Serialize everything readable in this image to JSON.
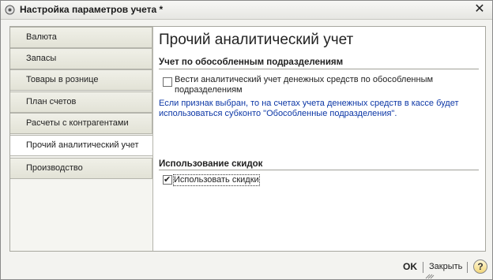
{
  "window": {
    "title": "Настройка параметров учета *",
    "close_icon": "close-icon"
  },
  "sidebar": {
    "items": [
      {
        "label": "Валюта",
        "active": false
      },
      {
        "label": "Запасы",
        "active": false
      },
      {
        "label": "Товары в рознице",
        "active": false
      },
      {
        "label": "План счетов",
        "active": false
      },
      {
        "label": "Расчеты с контрагентами",
        "active": false
      },
      {
        "label": "Прочий аналитический учет",
        "active": true
      },
      {
        "label": "Производство",
        "active": false
      }
    ]
  },
  "main": {
    "title": "Прочий аналитический учет",
    "sections": [
      {
        "title": "Учет по обособленным подразделениям",
        "checkbox_label_line1": "Вести аналитический учет денежных средств по обособленным",
        "checkbox_label_line2": "подразделениям",
        "checked": false,
        "hint_line1": "Если признак выбран, то на счетах учета денежных средств в кассе будет",
        "hint_line2": "использоваться субконто \"Обособленные подразделения\"."
      },
      {
        "title": "Использование скидок",
        "checkbox_label": "Использовать скидки",
        "checked": true
      }
    ]
  },
  "footer": {
    "ok_label": "OK",
    "close_label": "Закрыть",
    "help_label": "?"
  },
  "colors": {
    "hint": "#0c37a6",
    "tab_bg": "#e2e2d6",
    "active_tab_bg": "#ffffff"
  }
}
